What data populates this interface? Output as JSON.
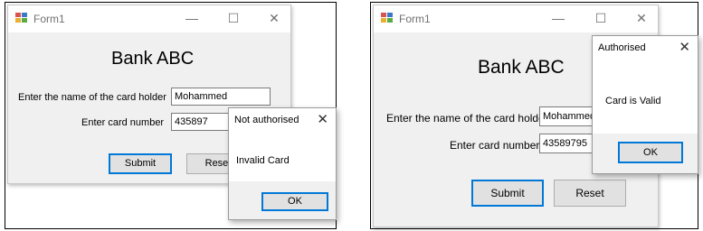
{
  "left": {
    "form": {
      "title": "Form1",
      "minimize": "—",
      "maximize": "☐",
      "close": "✕",
      "heading": "Bank ABC",
      "holder_label": "Enter the name of the card holder",
      "holder_value": "Mohammed",
      "card_label": "Enter card number",
      "card_value": "435897",
      "submit_label": "Submit",
      "reset_label": "Reset"
    },
    "dialog": {
      "title": "Not authorised",
      "close": "✕",
      "message": "Invalid Card",
      "ok_label": "OK"
    }
  },
  "right": {
    "form": {
      "title": "Form1",
      "minimize": "—",
      "maximize": "☐",
      "close": "✕",
      "heading": "Bank ABC",
      "holder_label": "Enter the name of the card holder",
      "holder_value": "Mohammed",
      "card_label": "Enter card number",
      "card_value": "43589795",
      "submit_label": "Submit",
      "reset_label": "Reset"
    },
    "dialog": {
      "title": "Authorised",
      "close": "✕",
      "message": "Card is Valid",
      "ok_label": "OK"
    }
  },
  "colors": {
    "accent": "#0078d7",
    "window_bg": "#f0f0f0",
    "titlebar_bg": "#ffffff",
    "button_bg": "#e1e1e1"
  }
}
